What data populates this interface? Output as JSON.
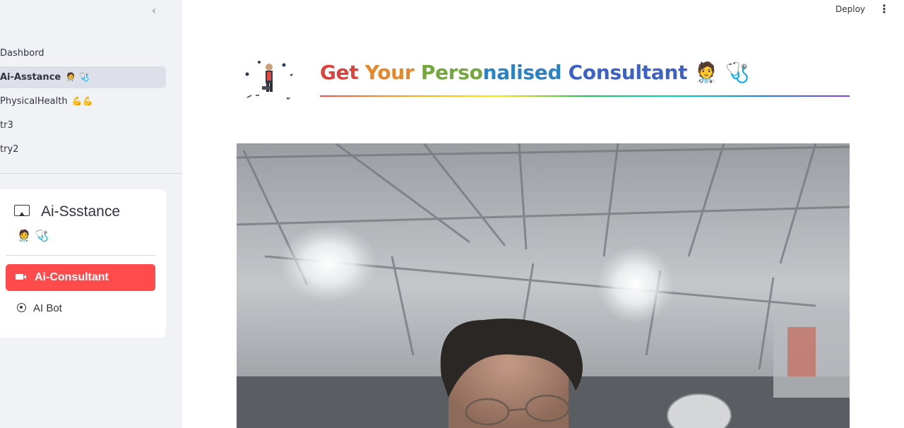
{
  "sidebar": {
    "collapse_glyph": "‹",
    "nav_items": [
      {
        "label": "Dashbord",
        "emoji": ""
      },
      {
        "label": "Ai-Asstance",
        "emoji": "🧑‍⚕️ 🩺"
      },
      {
        "label": "PhysicalHealth",
        "emoji": "💪💪"
      },
      {
        "label": "tr3",
        "emoji": ""
      },
      {
        "label": "try2",
        "emoji": ""
      }
    ],
    "active_index": 1,
    "menu": {
      "title": "Ai-Ssstance",
      "subtitle_emoji": "🧑‍⚕️ 🩺",
      "options": [
        {
          "label": "Ai-Consultant",
          "icon": "camera-video-icon",
          "selected": true
        },
        {
          "label": "AI Bot",
          "icon": "chat-icon",
          "selected": false
        }
      ],
      "accent_color": "#ff4b4b"
    }
  },
  "topbar": {
    "deploy_label": "Deploy",
    "menu_glyph": "⋮"
  },
  "header": {
    "title_parts": [
      "Get",
      " Your",
      " Perso",
      "nalised",
      " Consultant"
    ],
    "title_emoji": " 🧑‍⚕️ 🩺"
  }
}
